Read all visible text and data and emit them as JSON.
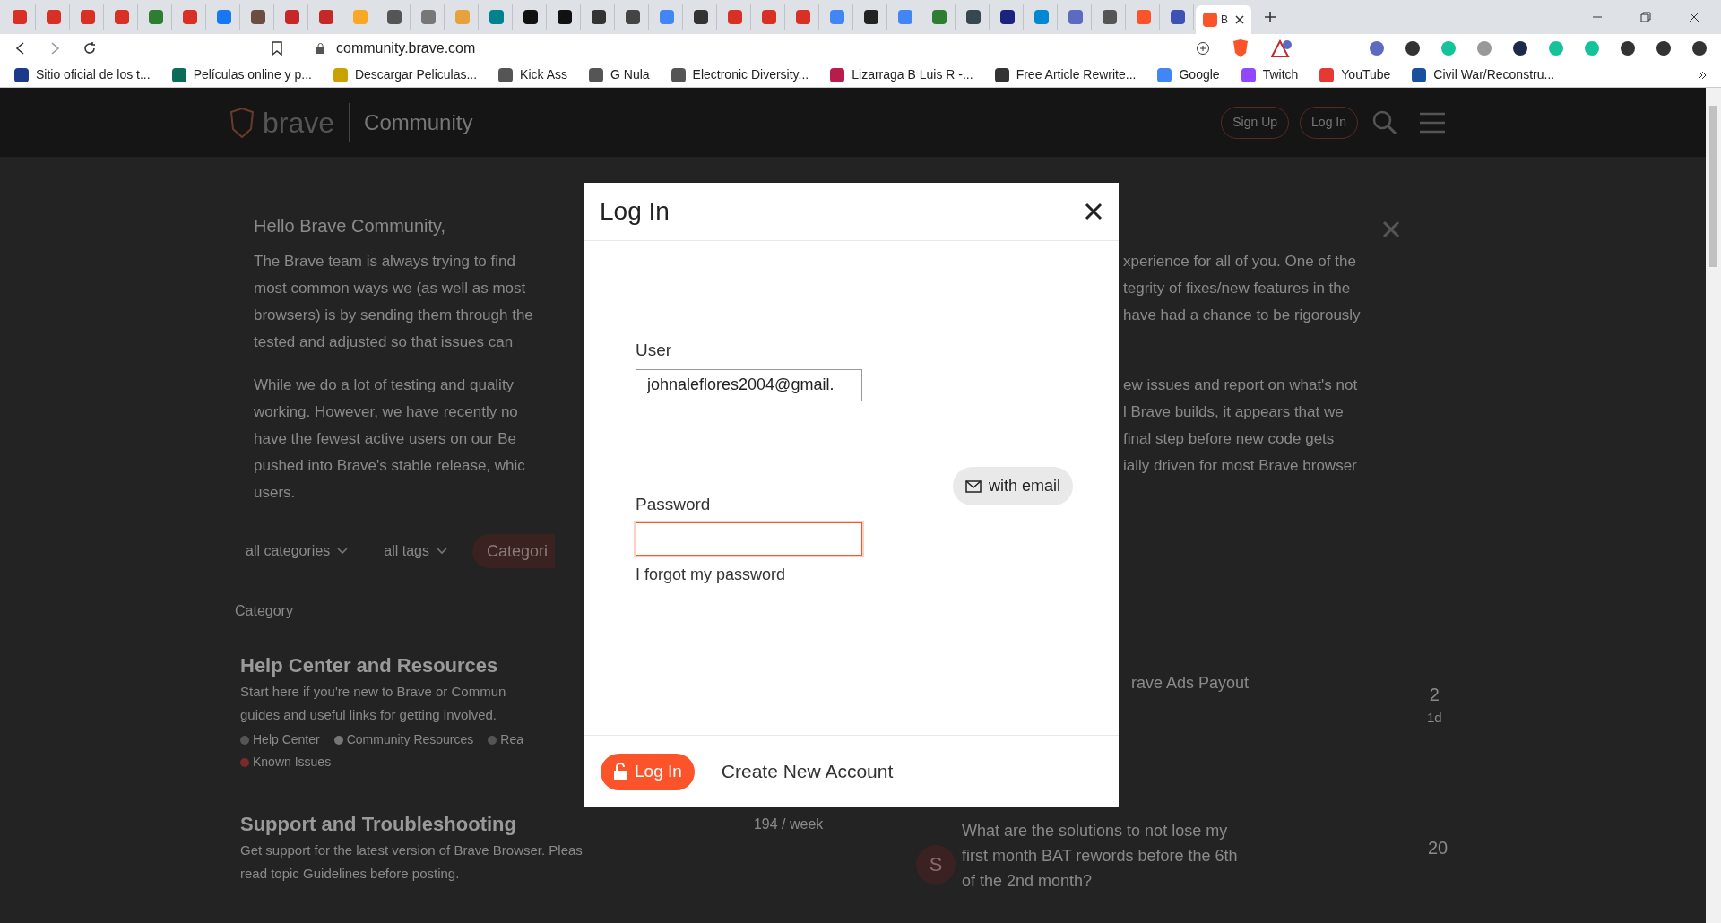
{
  "browser": {
    "tabs": [
      {
        "color": "#d93025",
        "selected": false
      },
      {
        "color": "#d93025",
        "selected": false
      },
      {
        "color": "#d93025",
        "selected": false
      },
      {
        "color": "#d93025",
        "selected": false
      },
      {
        "color": "#2e7d32",
        "selected": false
      },
      {
        "color": "#d93025",
        "selected": false
      },
      {
        "color": "#1877f2",
        "selected": false
      },
      {
        "color": "#6d4c41",
        "selected": false
      },
      {
        "color": "#c62828",
        "selected": false
      },
      {
        "color": "#c62828",
        "selected": false
      },
      {
        "color": "#f9a825",
        "selected": false
      },
      {
        "color": "#555555",
        "selected": false
      },
      {
        "color": "#777777",
        "selected": false
      },
      {
        "color": "#e6a23c",
        "selected": false
      },
      {
        "color": "#00838f",
        "selected": false
      },
      {
        "color": "#111111",
        "selected": false
      },
      {
        "color": "#111111",
        "selected": false
      },
      {
        "color": "#333333",
        "selected": false
      },
      {
        "color": "#444444",
        "selected": false
      },
      {
        "color": "#4285f4",
        "selected": false
      },
      {
        "color": "#333333",
        "selected": false
      },
      {
        "color": "#d93025",
        "selected": false
      },
      {
        "color": "#d93025",
        "selected": false
      },
      {
        "color": "#d93025",
        "selected": false
      },
      {
        "color": "#4285f4",
        "selected": false
      },
      {
        "color": "#222222",
        "selected": false
      },
      {
        "color": "#4285f4",
        "selected": false
      },
      {
        "color": "#2e7d32",
        "selected": false
      },
      {
        "color": "#37474f",
        "selected": false
      },
      {
        "color": "#1a237e",
        "selected": false
      },
      {
        "color": "#0288d1",
        "selected": false
      },
      {
        "color": "#5c6bc0",
        "selected": false
      },
      {
        "color": "#555555",
        "selected": false
      },
      {
        "color": "#fb542b",
        "selected": false
      },
      {
        "color": "#3f51b5",
        "selected": false
      },
      {
        "color": "#fb542b",
        "label": "B",
        "selected": true
      }
    ],
    "url": "community.brave.com",
    "bookmarks": [
      {
        "label": "Sitio oficial de los t...",
        "color": "#1a3a8a"
      },
      {
        "label": "Películas online y p...",
        "color": "#0a6b5a"
      },
      {
        "label": "Descargar Peliculas...",
        "color": "#c8a200"
      },
      {
        "label": "Kick Ass",
        "color": "#555555"
      },
      {
        "label": "G Nula",
        "color": "#555555"
      },
      {
        "label": "Electronic Diversity...",
        "color": "#555555"
      },
      {
        "label": "Lizarraga B Luis R -...",
        "color": "#b71c4a"
      },
      {
        "label": "Free Article Rewrite...",
        "color": "#333333"
      },
      {
        "label": "Google",
        "color": "#4285f4"
      },
      {
        "label": "Twitch",
        "color": "#9146ff"
      },
      {
        "label": "YouTube",
        "color": "#e53935"
      },
      {
        "label": "Civil War/Reconstru...",
        "color": "#1a4fa0"
      }
    ]
  },
  "site": {
    "logo": "brave",
    "section": "Community",
    "sign_up": "Sign Up",
    "log_in": "Log In"
  },
  "banner": {
    "title": "Hello Brave Community,",
    "paragraph_1_left": [
      "The Brave team is always trying to find",
      "most common ways we (as well as most",
      "browsers) is by sending them through the",
      "tested and adjusted so that issues can"
    ],
    "paragraph_1_right": [
      "xperience for all of you. One of the",
      "tegrity of fixes/new features in the",
      "have had a chance to be rigorously"
    ],
    "paragraph_2_left": [
      "While we do a lot of testing and quality",
      "working. However, we have recently no",
      "have the fewest active users on our Be",
      "pushed into Brave's stable release, whic",
      "users."
    ],
    "paragraph_2_right": [
      "ew issues and report on what's not",
      "l Brave builds, it appears that we",
      "final step before new code gets",
      "ially driven for most Brave browser"
    ]
  },
  "filters": {
    "categories": "all categories",
    "tags": "all tags",
    "button": "Categori"
  },
  "category_heading": "Category",
  "categories": [
    {
      "title": "Help Center and Resources",
      "description": [
        "Start here if you're new to Brave or Commun",
        "guides and useful links for getting involved."
      ],
      "subcategories": [
        {
          "label": "Help Center",
          "color": "#555555"
        },
        {
          "label": "Community Resources",
          "color": "#777777"
        },
        {
          "label": "Rea",
          "color": "#555555"
        },
        {
          "label": "Known Issues",
          "color": "#7a2a2a"
        }
      ]
    },
    {
      "title": "Support and Troubleshooting",
      "description": [
        "Get support for the latest version of Brave Browser. Pleas",
        "read topic Guidelines before posting."
      ],
      "stat": "194 / week"
    }
  ],
  "topics": [
    {
      "title": [
        "rave Ads Payout"
      ],
      "replies": "2",
      "age": "1d"
    },
    {
      "avatar": "S",
      "title": [
        "What are the solutions to not lose my",
        "first month BAT rewords before the 6th",
        "of the 2nd month?"
      ],
      "replies": "20"
    }
  ],
  "modal": {
    "title": "Log In",
    "user_label": "User",
    "user_value": "johnaleflores2004@gmail.",
    "password_label": "Password",
    "password_focused": true,
    "forgot": "I forgot my password",
    "email_button": "with email",
    "login_button": "Log In",
    "create_account": "Create New Account"
  }
}
